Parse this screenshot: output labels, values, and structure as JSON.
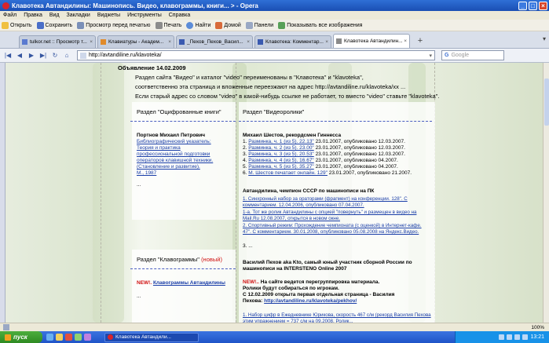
{
  "window": {
    "title": "Клавотека Автандилины: Машинопись. Видео, клавограммы, книги... > - Opera",
    "controls": {
      "minimize": "_",
      "maximize": "□",
      "close": "×"
    }
  },
  "menu": [
    "Файл",
    "Правка",
    "Вид",
    "Закладки",
    "Виджеты",
    "Инструменты",
    "Справка"
  ],
  "toolbar": {
    "open": "Открыть",
    "save": "Сохранить",
    "print_preview": "Просмотр перед печатью",
    "print": "Печать",
    "find": "Найти",
    "home": "Домой",
    "panels": "Панели",
    "show_images": "Показывать все изображения"
  },
  "tabs": [
    {
      "label": "tulkor.net :: Просмотр т...",
      "active": false
    },
    {
      "label": "Клавиатуры - Академ...",
      "active": false
    },
    {
      "label": "_Пехов_Пехов_Васил...",
      "active": false
    },
    {
      "label": "Клавотека: Комментар...",
      "active": false
    },
    {
      "label": "Клавотека Автандилин...",
      "active": true
    }
  ],
  "address": {
    "url": "http://avtandiline.ru/klavoteka/",
    "search_placeholder": "Google"
  },
  "announcement": {
    "date": "Объявление 14.02.2009",
    "line1": "Раздел сайта \"Видео\" и каталог \"video\" переименованы в \"Клавотека\" и \"klavoteka\",",
    "line2": "соответственно эта страница и вложенные переезжают на адрес http://avtandiline.ru/klavoteka/xx ...",
    "line3": "Если старый адрес со словом \"video\" в какой-нибудь ссылке не работает, то вместо \"video\" ставьте \"klavoteka\"."
  },
  "books": {
    "header": "Раздел \"Оцифрованные книги\"",
    "author": "Портнов Михаил Петрович",
    "link_lines": [
      "Библиографический указатель:",
      "Теория и практика",
      "профессиональной подготовки",
      "операторов клавишной техники.",
      "(Становление и развитие).",
      "М., 1987"
    ],
    "more": "..."
  },
  "videos": {
    "header": "Раздел \"Видеоролики\"",
    "group1_title": "Михаил Шестов, рекордсмен Гиннесса",
    "group1_items": [
      {
        "n": "1.",
        "link": "Разминка, ч. 1 (из 5). 22.13\"",
        "rest": "23.01.2007, опубликовано 12.03.2007."
      },
      {
        "n": "2.",
        "link": "Разминка, ч. 2 (из 5). 23.00\"",
        "rest": "23.01.2007, опубликовано 12.03.2007."
      },
      {
        "n": "3.",
        "link": "Разминка, ч. 3 (из 5). 20.53\"",
        "rest": "23.01.2007, опубликовано 12.03.2007."
      },
      {
        "n": "4.",
        "link": "Разминка, ч. 4 (из 5). 16.67\"",
        "rest": "23.01.2007, опубликовано 04.2007."
      },
      {
        "n": "5.",
        "link": "Разминка, ч. 5 (из 5). 35.27\"",
        "rest": "23.01.2007, опубликовано 04.2007."
      },
      {
        "n": "6.",
        "link": "М. Шестов печатает онлайн. 129\"",
        "rest": "23.01.2007, опубликовано 21.2007."
      }
    ],
    "group2_title": "Автандилина, чемпион СССР по машинописи на ПК",
    "group2_lines": [
      "1. Синхронный набор за ораторами (фрагмент) на конференции. 128\". С комментарием. 12.04.2006, опубликовано 07.04.2007.",
      "1-a. Тот же ролик Автандилины с опцией \"повернуть\" и размещен в видео на Mail.Ru 12.08.2007, открытся в новом окне.",
      "2. Спортивный режим: Прохождение чемпионата (с оценкой) в Интернет-кафе. 47\". С комментарием. 30.01.2008, опубликовано 05.08.2008 на Яндекс.Видео.",
      "3. ..."
    ],
    "group3_title": "Василий Пехов aka Kto, самый юный участник сборной России по машинописи на INTERSTENO Online 2007",
    "new_label": "NEW!..",
    "group3_text1": "На сайте ведется перегруппировка материала.",
    "group3_text2": "Ролики будут собираться по игрокам.",
    "group3_text3": "С 12.02.2009 открыта первая отдельная страница - Василия",
    "group3_text4": "Пехова:",
    "group3_link": "http://avtandiline.ru/klavoteka/pekhov/",
    "group3_item": "1. Набор цифр в Ежедневнике Юрикова, скорость 467 с/м (рекорд Василия Пехова этим упражнением = 737 с/м на 09.2008. Ролик..."
  },
  "klavogrammy": {
    "header": "Раздел \"Клавограммы\"",
    "header_new": "(новый)",
    "new_label": "NEW!.",
    "link": "Клавограммы Автандилины",
    "more": "..."
  },
  "status": {
    "zoom": "100%"
  },
  "taskbar": {
    "start": "пуск",
    "task": "Клавотека Автандили...",
    "time": "13:21"
  }
}
